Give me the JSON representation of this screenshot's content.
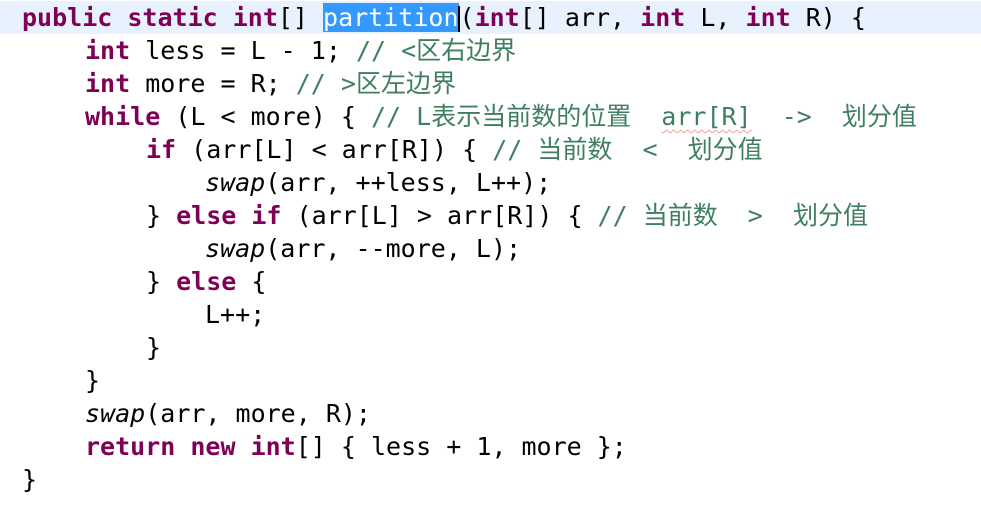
{
  "code": {
    "l1": {
      "kw1": "public static int",
      "t1": "[] ",
      "selected": "partition",
      "t2": "(",
      "kw2": "int",
      "t3": "[] arr, ",
      "kw3": "int",
      "t4": " L, ",
      "kw4": "int",
      "t5": " R) {"
    },
    "l2": {
      "kw": "int",
      "t": " less = L - 1; ",
      "cm": "// <区右边界"
    },
    "l3": {
      "kw": "int",
      "t": " more = R; ",
      "cm": "// >区左边界"
    },
    "l4": {
      "kw": "while",
      "t": " (L < more) { ",
      "cm1": "// L表示当前数的位置  ",
      "cm2": "arr[R]",
      "cm3": "  ->  划分值"
    },
    "l5": {
      "kw": "if",
      "t": " (arr[L] < arr[R]) { ",
      "cm": "// 当前数  <  划分值"
    },
    "l6": {
      "fn": "swap",
      "t": "(arr, ++less, L++);"
    },
    "l7": {
      "t1": "} ",
      "kw1": "else if",
      "t2": " (arr[L] > arr[R]) { ",
      "cm": "// 当前数  >  划分值"
    },
    "l8": {
      "fn": "swap",
      "t": "(arr, --more, L);"
    },
    "l9": {
      "t1": "} ",
      "kw": "else",
      "t2": " {"
    },
    "l10": {
      "t": "L++;"
    },
    "l11": {
      "t": "}"
    },
    "l12": {
      "t": "}"
    },
    "l13": {
      "fn": "swap",
      "t": "(arr, more, R);"
    },
    "l14": {
      "kw1": "return new int",
      "t1": "[] { less + 1, more };"
    },
    "l15": {
      "t": "}"
    }
  },
  "colors": {
    "keyword": "#7f0055",
    "comment": "#3f7f5f",
    "selection": "#3399ff",
    "current_line": "#e8f2fe"
  }
}
